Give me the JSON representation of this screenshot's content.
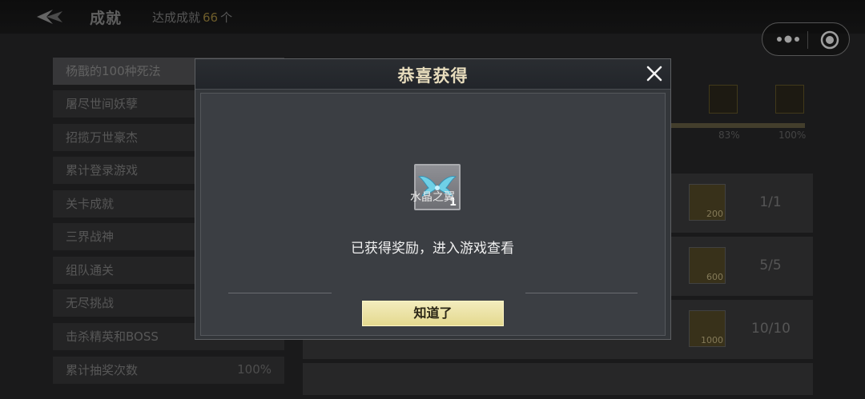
{
  "header": {
    "title": "成就",
    "achieved_label": "达成成就",
    "achieved_count": "66",
    "achieved_unit": "个"
  },
  "categories": [
    {
      "label": "杨戬的100种死法",
      "pct": ""
    },
    {
      "label": "屠尽世间妖孽",
      "pct": ""
    },
    {
      "label": "招揽万世豪杰",
      "pct": ""
    },
    {
      "label": "累计登录游戏",
      "pct": ""
    },
    {
      "label": "关卡成就",
      "pct": ""
    },
    {
      "label": "三界战神",
      "pct": ""
    },
    {
      "label": "组队通关",
      "pct": ""
    },
    {
      "label": "无尽挑战",
      "pct": ""
    },
    {
      "label": "击杀精英和BOSS",
      "pct": ""
    },
    {
      "label": "累计抽奖次数",
      "pct": "100%"
    }
  ],
  "progress": {
    "marks": [
      "83%",
      "100%"
    ]
  },
  "reward_rows": [
    {
      "coin_amount": "200",
      "count": "1/1"
    },
    {
      "coin_amount": "600",
      "count": "5/5"
    },
    {
      "coin_amount": "1000",
      "count": "10/10"
    }
  ],
  "dialog": {
    "title": "恭喜获得",
    "item_name": "水晶之翼",
    "item_qty": "1",
    "message": "已获得奖励，进入游戏查看",
    "ok_label": "知道了"
  },
  "colors": {
    "accent_gold": "#b09545",
    "button_yellow": "#e4d98f",
    "dialog_title": "#e8ddbd"
  }
}
